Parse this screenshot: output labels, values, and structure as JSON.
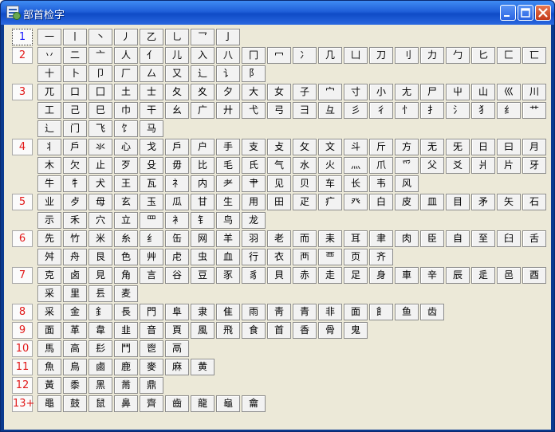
{
  "window": {
    "title": "部首检字"
  },
  "rows": [
    {
      "stroke": "1",
      "selected": true,
      "chars": [
        "一",
        "丨",
        "丶",
        "丿",
        "乙",
        "乚",
        "乛",
        "亅"
      ]
    },
    {
      "stroke": "2",
      "chars": [
        "丷",
        "二",
        "亠",
        "人",
        "亻",
        "儿",
        "入",
        "八",
        "冂",
        "冖",
        "冫",
        "几",
        "凵",
        "刀",
        "刂",
        "力",
        "勹",
        "匕",
        "匚",
        "匸"
      ]
    },
    {
      "stroke": "",
      "chars": [
        "十",
        "卜",
        "卩",
        "厂",
        "厶",
        "又",
        "⻌",
        "讠",
        "阝"
      ]
    },
    {
      "stroke": "3",
      "chars": [
        "兀",
        "口",
        "囗",
        "土",
        "士",
        "夂",
        "夊",
        "夕",
        "大",
        "女",
        "子",
        "宀",
        "寸",
        "小",
        "尢",
        "尸",
        "屮",
        "山",
        "巛",
        "川"
      ]
    },
    {
      "stroke": "",
      "chars": [
        "工",
        "己",
        "巳",
        "巾",
        "干",
        "幺",
        "广",
        "廾",
        "弋",
        "弓",
        "彐",
        "彑",
        "彡",
        "彳",
        "忄",
        "扌",
        "氵",
        "犭",
        "纟",
        "艹"
      ]
    },
    {
      "stroke": "",
      "chars": [
        "辶",
        "门",
        "飞",
        "饣",
        "马"
      ]
    },
    {
      "stroke": "4",
      "chars": [
        "丬",
        "戶",
        "氺",
        "心",
        "戈",
        "戶",
        "户",
        "手",
        "支",
        "攴",
        "攵",
        "文",
        "斗",
        "斤",
        "方",
        "无",
        "旡",
        "日",
        "曰",
        "月"
      ]
    },
    {
      "stroke": "",
      "chars": [
        "木",
        "欠",
        "止",
        "歹",
        "殳",
        "毋",
        "比",
        "毛",
        "氏",
        "气",
        "水",
        "火",
        "灬",
        "爪",
        "爫",
        "父",
        "爻",
        "爿",
        "片",
        "牙"
      ]
    },
    {
      "stroke": "",
      "chars": [
        "牛",
        "牜",
        "犬",
        "王",
        "瓦",
        "礻",
        "内",
        "耂",
        "肀",
        "见",
        "贝",
        "车",
        "长",
        "韦",
        "风"
      ]
    },
    {
      "stroke": "5",
      "chars": [
        "业",
        "歺",
        "母",
        "玄",
        "玉",
        "瓜",
        "甘",
        "生",
        "用",
        "田",
        "疋",
        "疒",
        "癶",
        "白",
        "皮",
        "皿",
        "目",
        "矛",
        "矢",
        "石"
      ]
    },
    {
      "stroke": "",
      "chars": [
        "示",
        "禾",
        "穴",
        "立",
        "罒",
        "衤",
        "钅",
        "鸟",
        "龙"
      ]
    },
    {
      "stroke": "6",
      "chars": [
        "先",
        "竹",
        "米",
        "糸",
        "纟",
        "缶",
        "网",
        "羊",
        "羽",
        "老",
        "而",
        "耒",
        "耳",
        "聿",
        "肉",
        "臣",
        "自",
        "至",
        "臼",
        "舌"
      ]
    },
    {
      "stroke": "",
      "chars": [
        "舛",
        "舟",
        "艮",
        "色",
        "艸",
        "虍",
        "虫",
        "血",
        "行",
        "衣",
        "襾",
        "覀",
        "页",
        "齐"
      ]
    },
    {
      "stroke": "7",
      "chars": [
        "克",
        "卤",
        "見",
        "角",
        "言",
        "谷",
        "豆",
        "豕",
        "豸",
        "貝",
        "赤",
        "走",
        "足",
        "身",
        "車",
        "辛",
        "辰",
        "辵",
        "邑",
        "酉"
      ]
    },
    {
      "stroke": "",
      "chars": [
        "采",
        "里",
        "镸",
        "麦"
      ]
    },
    {
      "stroke": "8",
      "chars": [
        "采",
        "金",
        "釒",
        "長",
        "門",
        "阜",
        "隶",
        "隹",
        "雨",
        "靑",
        "青",
        "非",
        "面",
        "飠",
        "鱼",
        "齿"
      ]
    },
    {
      "stroke": "9",
      "chars": [
        "面",
        "革",
        "韋",
        "韭",
        "音",
        "頁",
        "風",
        "飛",
        "食",
        "首",
        "香",
        "骨",
        "鬼"
      ]
    },
    {
      "stroke": "10",
      "chars": [
        "馬",
        "高",
        "髟",
        "鬥",
        "鬯",
        "鬲"
      ]
    },
    {
      "stroke": "11",
      "chars": [
        "魚",
        "鳥",
        "鹵",
        "鹿",
        "麥",
        "麻",
        "黄"
      ]
    },
    {
      "stroke": "12",
      "chars": [
        "黃",
        "黍",
        "黑",
        "黹",
        "鼎"
      ]
    },
    {
      "stroke": "13+",
      "chars": [
        "黽",
        "鼓",
        "鼠",
        "鼻",
        "齊",
        "齒",
        "龍",
        "龜",
        "龠"
      ]
    }
  ]
}
